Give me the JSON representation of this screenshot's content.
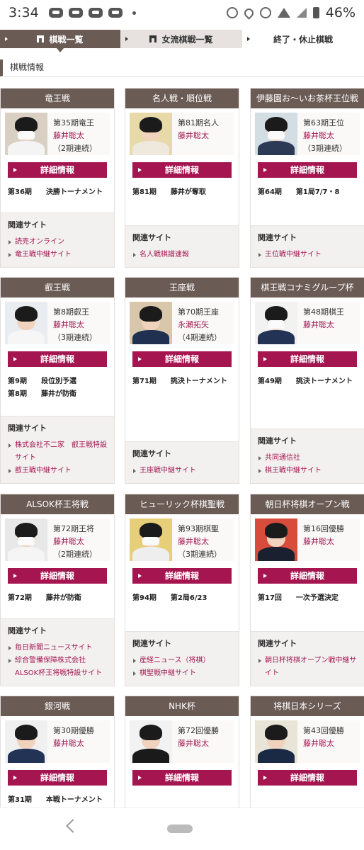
{
  "status_bar": {
    "time": "3:34",
    "battery": "46%"
  },
  "tabs": [
    {
      "label": "棋戦一覧",
      "active": true
    },
    {
      "label": "女流棋戦一覧"
    },
    {
      "label": "終了・休止棋戦"
    }
  ],
  "section_title": "棋戦情報",
  "related_label": "関連サイト",
  "details_label": "詳細情報",
  "colors": {
    "header": "#6b5b55",
    "accent": "#a51550",
    "link": "#a31a53"
  },
  "cards": [
    {
      "title": "竜王戦",
      "period": "第35期竜王",
      "holder": "藤井聡太",
      "note": "（2期連続）",
      "status": [
        [
          "第36期",
          "決勝トーナメント"
        ]
      ],
      "links": [
        "読売オンライン",
        "竜王戦中継サイト"
      ]
    },
    {
      "title": "名人戦・順位戦",
      "period": "第81期名人",
      "holder": "藤井聡太",
      "note": "",
      "status": [
        [
          "第81期",
          "藤井が奪取"
        ]
      ],
      "links": [
        "名人戦棋譜速報"
      ]
    },
    {
      "title": "伊藤園お～いお茶杯王位戦",
      "period": "第63期王位",
      "holder": "藤井聡太",
      "note": "（3期連続）",
      "status": [
        [
          "第64期",
          "第1局7/7・8"
        ]
      ],
      "links": [
        "王位戦中継サイト"
      ]
    },
    {
      "title": "叡王戦",
      "period": "第8期叡王",
      "holder": "藤井聡太",
      "note": "（3期連続）",
      "status": [
        [
          "第9期",
          "段位別予選"
        ],
        [
          "第8期",
          "藤井が防衛"
        ]
      ],
      "links": [
        "株式会社不二家　叡王戦特設サイト",
        "叡王戦中継サイト"
      ]
    },
    {
      "title": "王座戦",
      "period": "第70期王座",
      "holder": "永瀬拓矢",
      "note": "（4期連続）",
      "status": [
        [
          "第71期",
          "挑決トーナメント"
        ]
      ],
      "links": [
        "王座戦中継サイト"
      ]
    },
    {
      "title": "棋王戦コナミグループ杯",
      "period": "第48期棋王",
      "holder": "藤井聡太",
      "note": "",
      "status": [
        [
          "第49期",
          "挑決トーナメント"
        ]
      ],
      "links": [
        "共同通信社",
        "棋王戦中継サイト"
      ]
    },
    {
      "title": "ALSOK杯王将戦",
      "period": "第72期王将",
      "holder": "藤井聡太",
      "note": "（2期連続）",
      "status": [
        [
          "第72期",
          "藤井が防衛"
        ]
      ],
      "links": [
        "毎日新聞ニュースサイト",
        "綜合警備保障株式会社ALSOK杯王将戦特設サイト"
      ]
    },
    {
      "title": "ヒューリック杯棋聖戦",
      "period": "第93期棋聖",
      "holder": "藤井聡太",
      "note": "（3期連続）",
      "status": [
        [
          "第94期",
          "第2局6/23"
        ]
      ],
      "links": [
        "産経ニュース（将棋）",
        "棋聖戦中継サイト"
      ]
    },
    {
      "title": "朝日杯将棋オープン戦",
      "period": "第16回優勝",
      "holder": "藤井聡太",
      "note": "",
      "status": [
        [
          "第17回",
          "一次予選決定"
        ]
      ],
      "links": [
        "朝日杯将棋オープン戦中継サイト"
      ]
    },
    {
      "title": "銀河戦",
      "period": "第30期優勝",
      "holder": "藤井聡太",
      "note": "",
      "status": [
        [
          "第31期",
          "本戦トーナメント"
        ]
      ],
      "links": []
    },
    {
      "title": "NHK杯",
      "period": "第72回優勝",
      "holder": "藤井聡太",
      "note": "",
      "status": [],
      "links": []
    },
    {
      "title": "将棋日本シリーズ",
      "period": "第43回優勝",
      "holder": "藤井聡太",
      "note": "",
      "status": [],
      "links": []
    }
  ]
}
